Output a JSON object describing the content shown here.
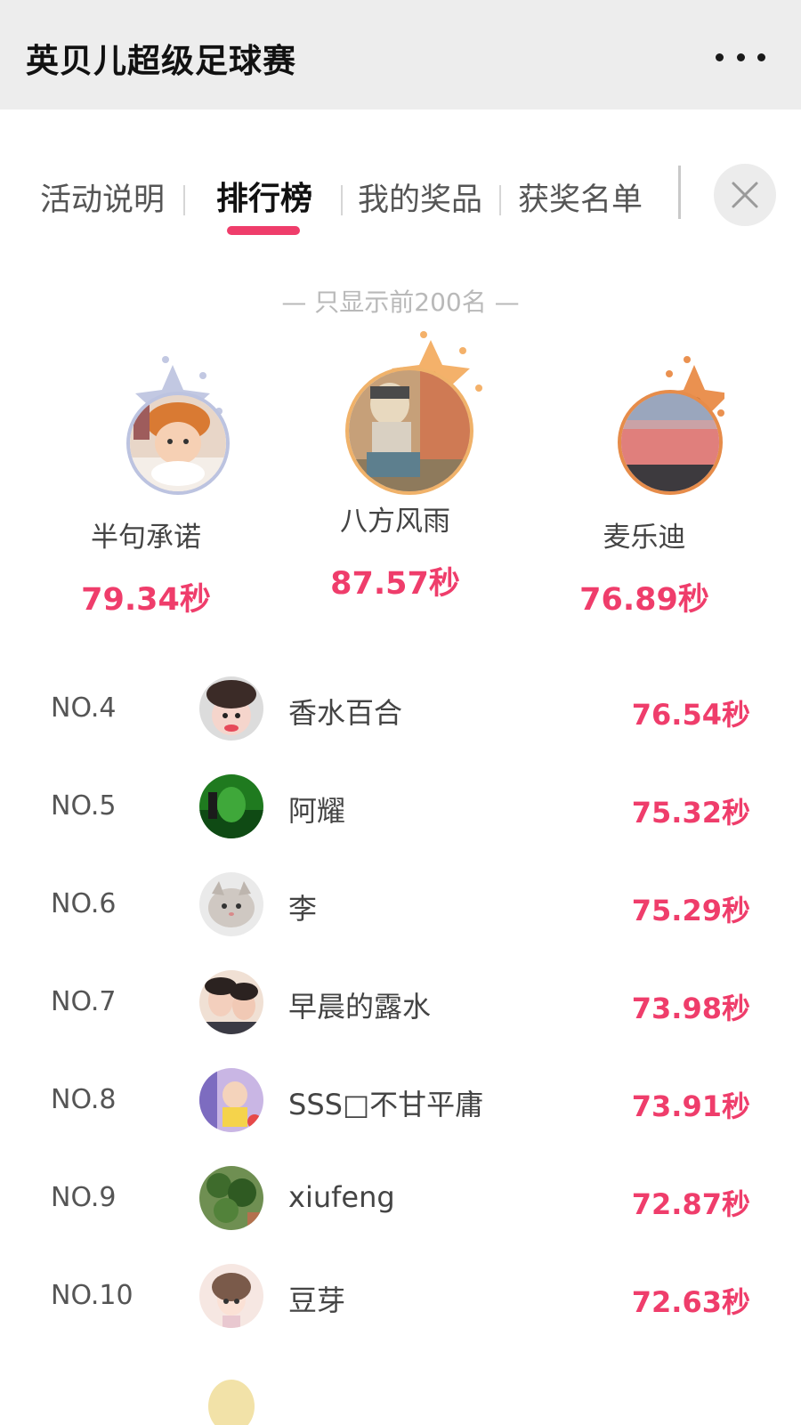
{
  "titlebar": {
    "title": "英贝儿超级足球赛",
    "menu_icon": "more-dots-icon"
  },
  "tabs": [
    {
      "label": "活动说明",
      "active": false
    },
    {
      "label": "排行榜",
      "active": true
    },
    {
      "label": "我的奖品",
      "active": false
    },
    {
      "label": "获奖名单",
      "active": false
    }
  ],
  "close_icon": "close-icon",
  "notice": "— 只显示前200名 —",
  "podium": [
    {
      "rank": "2",
      "name": "半句承诺",
      "score": "79.34秒"
    },
    {
      "rank": "1",
      "name": "八方风雨",
      "score": "87.57秒"
    },
    {
      "rank": "3",
      "name": "麦乐迪",
      "score": "76.89秒"
    }
  ],
  "list": [
    {
      "rank": "NO.4",
      "name": "香水百合",
      "score": "76.54秒"
    },
    {
      "rank": "NO.5",
      "name": "阿耀",
      "score": "75.32秒"
    },
    {
      "rank": "NO.6",
      "name": "李",
      "score": "75.29秒"
    },
    {
      "rank": "NO.7",
      "name": "早晨的露水",
      "score": "73.98秒"
    },
    {
      "rank": "NO.8",
      "name": "SSS□不甘平庸",
      "score": "73.91秒"
    },
    {
      "rank": "NO.9",
      "name": "xiufeng",
      "score": "72.87秒"
    },
    {
      "rank": "NO.10",
      "name": "豆芽",
      "score": "72.63秒"
    }
  ],
  "colors": {
    "accent": "#ef3d6b",
    "gold": "#f0a64b",
    "silver": "#b8bfdc",
    "bronze": "#e58b47"
  }
}
